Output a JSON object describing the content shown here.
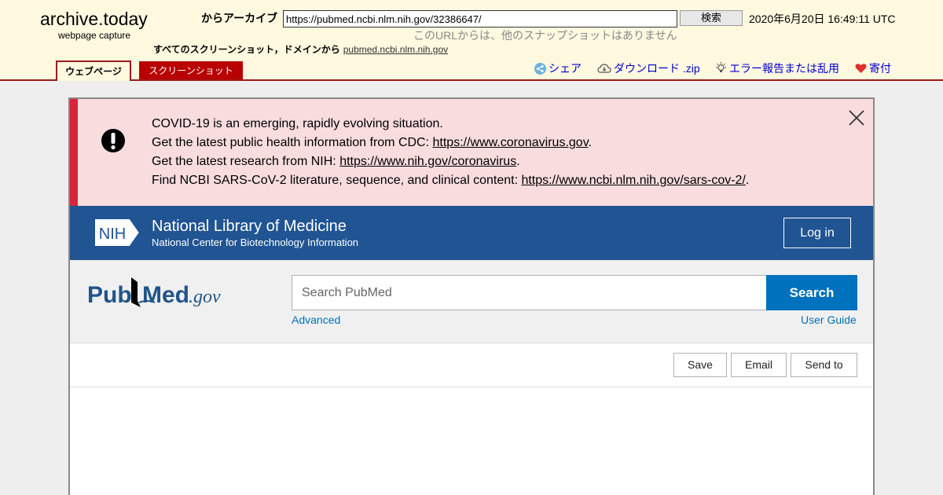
{
  "archive": {
    "logo": "archive.today",
    "subtitle": "webpage capture",
    "from_label": "からアーカイブ",
    "url_value": "https://pubmed.ncbi.nlm.nih.gov/32386647/",
    "search_button": "検索",
    "date": "2020年6月20日 16:49:11 UTC",
    "no_snapshots": "このURLからは、他のスナップショットはありません",
    "all_domain_prefix": "すべてのスクリーンショット，ドメインから",
    "all_domain_link": "pubmed.ncbi.nlm.nih.gov",
    "tabs": {
      "webpage": "ウェブページ",
      "screenshot": "スクリーンショット"
    },
    "links": {
      "share": "シェア",
      "download": "ダウンロード .zip",
      "report": "エラー報告または乱用",
      "donate": "寄付"
    }
  },
  "covid": {
    "line1": "COVID-19 is an emerging, rapidly evolving situation.",
    "line2_prefix": "Get the latest public health information from CDC: ",
    "line2_link": "https://www.coronavirus.gov",
    "line3_prefix": "Get the latest research from NIH: ",
    "line3_link": "https://www.nih.gov/coronavirus",
    "line4_prefix": "Find NCBI SARS-CoV-2 literature, sequence, and clinical content: ",
    "line4_link": "https://www.ncbi.nlm.nih.gov/sars-cov-2/",
    "period": "."
  },
  "nih": {
    "logo_text": "NIH",
    "title": "National Library of Medicine",
    "subtitle": "National Center for Biotechnology Information",
    "login": "Log in"
  },
  "pubmed": {
    "logo_pub": "Pub",
    "logo_med": "Med",
    "logo_gov": ".gov",
    "search_placeholder": "Search PubMed",
    "search_button": "Search",
    "advanced": "Advanced",
    "user_guide": "User Guide"
  },
  "actions": {
    "save": "Save",
    "email": "Email",
    "send_to": "Send to"
  },
  "colors": {
    "archive_bg": "#fff9e0",
    "archive_red": "#9b1c1c",
    "covid_bg": "#f8dcde",
    "covid_border": "#d9243a",
    "nih_blue": "#205493",
    "pubmed_blue": "#0071bc"
  },
  "icons": [
    "share-icon",
    "cloud-download-icon",
    "bulb-icon",
    "heart-icon",
    "exclamation-icon",
    "close-icon",
    "nih-logo",
    "pubmed-logo"
  ]
}
